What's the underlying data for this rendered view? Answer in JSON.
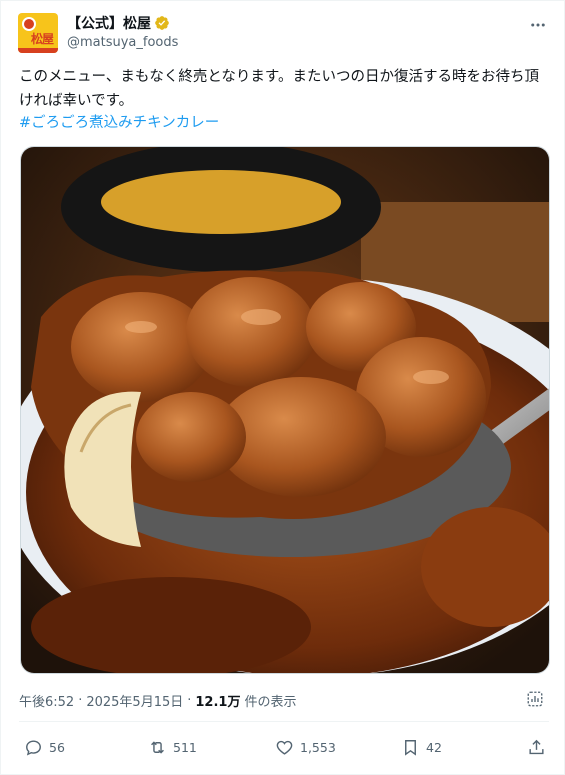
{
  "tweet": {
    "display_name": "【公式】松屋",
    "handle": "@matsuya_foods",
    "text": "このメニュー、まもなく終売となります。またいつの日か復活する時をお待ち頂ければ幸いです。",
    "hashtag": "#ごろごろ煮込みチキンカレー"
  },
  "meta": {
    "time": "午後6:52",
    "separator": "·",
    "date": "2025年5月15日",
    "views_count": "12.1万",
    "views_label": "件の表示"
  },
  "actions": {
    "replies": "56",
    "reposts": "511",
    "likes": "1,553",
    "bookmarks": "42"
  },
  "colors": {
    "accent": "#1d9bf0",
    "verified_badge": "#e2b719",
    "text_secondary": "#536471"
  },
  "icons": [
    "verified-badge-icon",
    "more-options-icon",
    "analytics-icon",
    "reply-icon",
    "repost-icon",
    "like-icon",
    "bookmark-icon",
    "share-icon"
  ]
}
